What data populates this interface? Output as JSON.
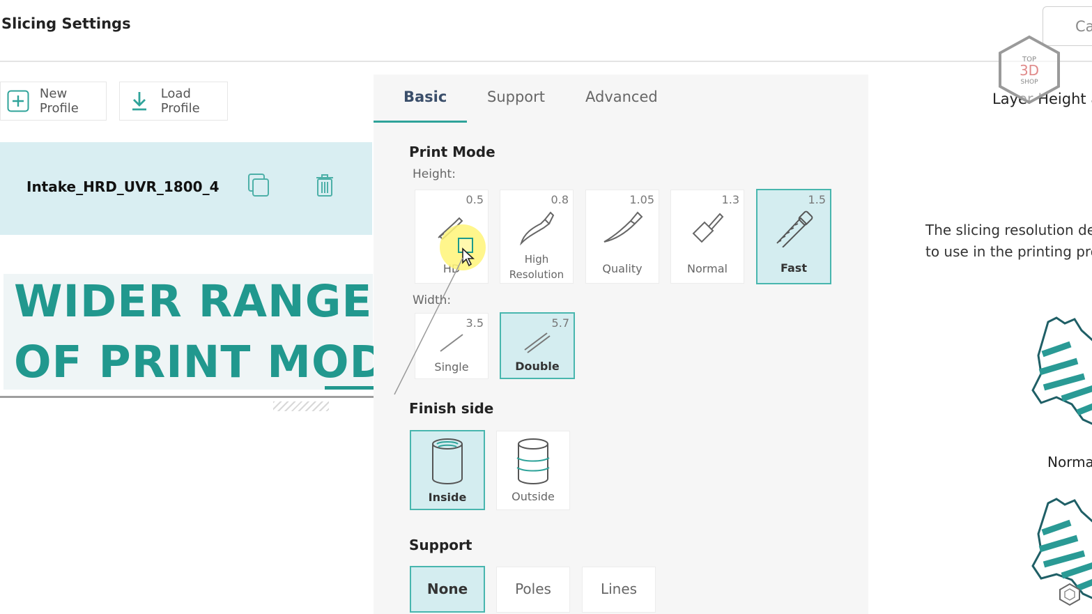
{
  "header": {
    "title": "Slicing Settings",
    "cancel_label": "Ca"
  },
  "watermark": {
    "line1": "TOP",
    "line2": "3D",
    "line3": "SHOP"
  },
  "profiles": {
    "new_label": "New Profile",
    "load_label": "Load Profile",
    "selected_name": "Intake_HRD_UVR_1800_4"
  },
  "overlay": {
    "line1": "WIDER RANGE",
    "line2": "OF PRINT MODES"
  },
  "tabs": [
    {
      "label": "Basic",
      "active": true
    },
    {
      "label": "Support",
      "active": false
    },
    {
      "label": "Advanced",
      "active": false
    }
  ],
  "print_mode": {
    "title": "Print Mode",
    "height_label": "Height:",
    "heights": [
      {
        "value": "0.5",
        "label": "HD",
        "selected": false
      },
      {
        "value": "0.8",
        "label": "High Resolution",
        "selected": false
      },
      {
        "value": "1.05",
        "label": "Quality",
        "selected": false
      },
      {
        "value": "1.3",
        "label": "Normal",
        "selected": false
      },
      {
        "value": "1.5",
        "label": "Fast",
        "selected": true
      }
    ],
    "width_label": "Width:",
    "widths": [
      {
        "value": "3.5",
        "label": "Single",
        "selected": false
      },
      {
        "value": "5.7",
        "label": "Double",
        "selected": true
      }
    ]
  },
  "finish_side": {
    "title": "Finish side",
    "options": [
      {
        "label": "Inside",
        "selected": true
      },
      {
        "label": "Outside",
        "selected": false
      }
    ]
  },
  "support": {
    "title": "Support",
    "options": [
      {
        "label": "None",
        "selected": true
      },
      {
        "label": "Poles",
        "selected": false
      },
      {
        "label": "Lines",
        "selected": false
      }
    ]
  },
  "right_panel": {
    "title": "Layer Height a",
    "desc_line1": "The slicing resolution de",
    "desc_line2": "to use in the printing pro",
    "mode_name": "Norma"
  },
  "colors": {
    "accent": "#2fa39a",
    "selected_bg": "#d4edf0",
    "overlay_text": "#21988e"
  }
}
